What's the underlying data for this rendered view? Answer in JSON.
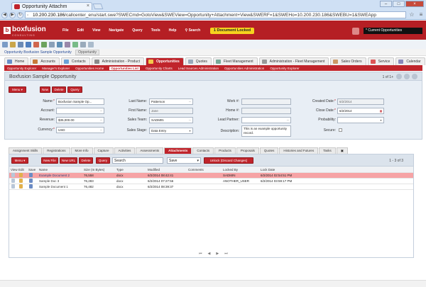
{
  "browser": {
    "tab_title": "Opportunity Attachm",
    "url_host": "10.200.230.186",
    "url_rest": "/callcenter_enu/start.swe?SWECmd=GotoView&SWEView=Opportunity+Attachment+View&SWERF=1&SWEHo=10.200.230.186&SWEBU=1&SWEApp"
  },
  "app": {
    "logo": "boxfusion",
    "logo_tag": "CONSULTING",
    "menu": [
      "File",
      "Edit",
      "View",
      "Navigate",
      "Query",
      "Tools",
      "Help",
      "Search"
    ],
    "lock_badge": "1 Document Locked",
    "current_context": "* Current Opportunities"
  },
  "breadcrumb": {
    "link": "Opportunity Boxfusion Sample Opportunity",
    "current": "Opportunity"
  },
  "screen_tabs": [
    {
      "label": "Home",
      "color": "#6a8fc8"
    },
    {
      "label": "Accounts",
      "color": "#c87a3a"
    },
    {
      "label": "Contacts",
      "color": "#6aa2d8"
    },
    {
      "label": "Administration - Product",
      "color": "#8a8a8a"
    },
    {
      "label": "Opportunities",
      "color": "#f2c94c",
      "active": true
    },
    {
      "label": "Quotes",
      "color": "#9ab"
    },
    {
      "label": "Fleet Management",
      "color": "#7a9"
    },
    {
      "label": "Administration - Fleet Management",
      "color": "#999"
    },
    {
      "label": "Sales Orders",
      "color": "#c96"
    },
    {
      "label": "Service",
      "color": "#d55"
    },
    {
      "label": "Calendar",
      "color": "#88b"
    }
  ],
  "sub_tabs": [
    {
      "label": "Opportunity Explorer"
    },
    {
      "label": "Manager's Explorer"
    },
    {
      "label": "Opportunities Home"
    },
    {
      "label": "Opportunities List",
      "active": true
    },
    {
      "label": "Opportunity Charts"
    },
    {
      "label": "Lead Sources Administration"
    },
    {
      "label": "Opportunities Administration"
    },
    {
      "label": "Opportunity Explorer"
    }
  ],
  "form": {
    "title": "Boxfusion Sample Opportunity",
    "pager": "1 of 1+",
    "buttons": {
      "menu": "Menu ▾",
      "new": "New",
      "delete": "Delete",
      "query": "Query"
    },
    "labels": {
      "name": "Name:",
      "account": "Account:",
      "revenue": "Revenue:",
      "currency": "Currency:",
      "last_name": "Last Name:",
      "first_name": "First Name:",
      "sales_team": "Sales Team:",
      "sales_stage": "Sales Stage:",
      "work": "Work #:",
      "home": "Home #:",
      "lead_partner": "Lead Partner:",
      "description": "Description:",
      "created_date": "Created Date:",
      "close_date": "Close Date:",
      "probability": "Probability:",
      "secure": "Secure:"
    },
    "values": {
      "name": "Boxfusion Sample Op...",
      "account": "",
      "revenue": "$35,000.00",
      "currency": "USD",
      "last_name": "Patterson",
      "first_name": "Jane",
      "sales_team": "SADMIN",
      "sales_stage": "Data Entry",
      "work": "",
      "home": "",
      "lead_partner": "",
      "description": "This is an example opportunity record.",
      "created_date": "6/2/2014",
      "close_date": "6/2/2014",
      "probability": ""
    }
  },
  "view_tabs": [
    {
      "label": "Assignment Skills"
    },
    {
      "label": "Registrations"
    },
    {
      "label": "More Info"
    },
    {
      "label": "Capture"
    },
    {
      "label": "Activities"
    },
    {
      "label": "Assessments"
    },
    {
      "label": "Attachments",
      "active": true
    },
    {
      "label": "Contacts"
    },
    {
      "label": "Products"
    },
    {
      "label": "Proposals"
    },
    {
      "label": "Quotes"
    },
    {
      "label": "Histories and Futures"
    },
    {
      "label": "Tasks"
    }
  ],
  "list": {
    "buttons": {
      "menu": "Menu ▾",
      "new_file": "New File",
      "new_url": "New URL",
      "delete": "Delete",
      "query": "Query",
      "unlock": "Unlock (Discard Changes)"
    },
    "search_placeholder": "Search",
    "save_select": "Save",
    "pager": "1 - 3 of 3",
    "columns": [
      "View",
      "Edit",
      "Save",
      "Name",
      "Size (In Bytes)",
      "Type",
      "Modified",
      "Comments",
      "Locked By",
      "Lock Date"
    ],
    "rows": [
      {
        "name": "Example Document 2",
        "size": "76,558",
        "type": "docx",
        "modified": "6/2/2014 08:42:41",
        "comments": "",
        "locked_by": "SADMIN",
        "lock_date": "6/2/2014 02:54:51 PM",
        "selected": true
      },
      {
        "name": "Sample Doc 3",
        "size": "76,283",
        "type": "docx",
        "modified": "6/2/2014 07:27:56",
        "comments": "",
        "locked_by": "ANOTHER_USER",
        "lock_date": "6/2/2014 03:59:17 PM",
        "selected": false
      },
      {
        "name": "Sample Document 1",
        "size": "76,482",
        "type": "docx",
        "modified": "6/2/2014 08:39:37",
        "comments": "",
        "locked_by": "",
        "lock_date": "",
        "selected": false
      }
    ],
    "pager_arrows": "⏮  ◀  ▶  ⏭"
  }
}
